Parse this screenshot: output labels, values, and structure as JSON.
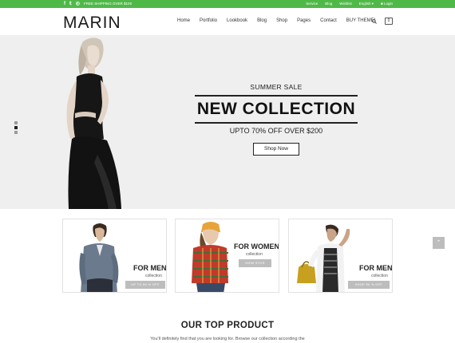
{
  "topbar": {
    "social": [
      "f",
      "𝕥",
      "◎"
    ],
    "shipping": "FREE SHIPPING OVER $100",
    "links": [
      "Service",
      "Blog",
      "Wishlist",
      "English ▾",
      "Login"
    ]
  },
  "header": {
    "logo": "MARIN",
    "nav": [
      "Home",
      "Portfolio",
      "Lookbook",
      "Blog",
      "Shop",
      "Pages",
      "Contact",
      "BUY THEME!"
    ],
    "cart_count": "0"
  },
  "hero": {
    "eyebrow": "SUMMER SALE",
    "headline": "NEW COLLECTION",
    "offer": "UPTO 70% OFF OVER $200",
    "cta": "Shop Now",
    "slides": 3,
    "active_slide": 2
  },
  "cards": [
    {
      "title": "FOR MEN",
      "subtitle": "collection",
      "button": "UP TO 50 % OFF"
    },
    {
      "title": "FOR WOMEN",
      "subtitle": "collection",
      "button": "VIEW STOR"
    },
    {
      "title": "FOR MEN",
      "subtitle": "collection",
      "button": "SHOP 50 % OFF"
    }
  ],
  "scroll_top": "⌃",
  "top_product": {
    "title": "OUR TOP PRODUCT",
    "description": "You'll definitely find that you are looking for. Browse our collection according the"
  },
  "colors": {
    "accent": "#4fb948",
    "hero_bg": "#efefef",
    "button_grey": "#bdbdbd"
  }
}
